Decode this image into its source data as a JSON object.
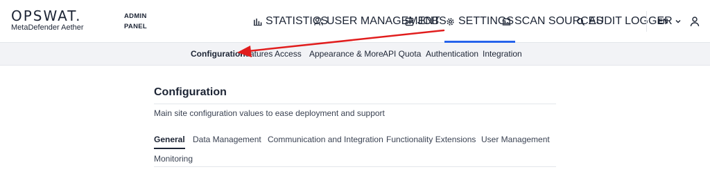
{
  "header": {
    "logo_word": "OPSWAT.",
    "logo_sub": "MetaDefender Aether",
    "admin_line1": "ADMIN",
    "admin_line2": "PANEL"
  },
  "nav": [
    {
      "label": "STATISTICS",
      "icon": "bar-chart-icon"
    },
    {
      "label": "USER MANAGEMENT",
      "icon": "users-icon"
    },
    {
      "label": "JOBS",
      "icon": "jobs-icon"
    },
    {
      "label": "SETTINGS",
      "icon": "gear-icon",
      "active": true
    },
    {
      "label": "SCAN SOURCES",
      "icon": "laptop-icon"
    },
    {
      "label": "AUDIT LOGGER",
      "icon": "search-icon"
    }
  ],
  "language": "EN",
  "subnav": [
    {
      "label": "Configuration",
      "active": true
    },
    {
      "label": "Features Access"
    },
    {
      "label": "Appearance & More"
    },
    {
      "label": "API Quota"
    },
    {
      "label": "Authentication"
    },
    {
      "label": "Integration"
    }
  ],
  "main": {
    "title": "Configuration",
    "description": "Main site configuration values to ease deployment and support",
    "tabs": [
      {
        "label": "General",
        "active": true
      },
      {
        "label": "Data Management"
      },
      {
        "label": "Communication and Integration"
      },
      {
        "label": "Functionality Extensions"
      },
      {
        "label": "User Management"
      },
      {
        "label": "Monitoring"
      }
    ]
  },
  "colors": {
    "accent": "#2563eb",
    "annotation_arrow": "#e11d1d",
    "subnav_bg": "#f2f3f6",
    "text": "#1c2434"
  }
}
